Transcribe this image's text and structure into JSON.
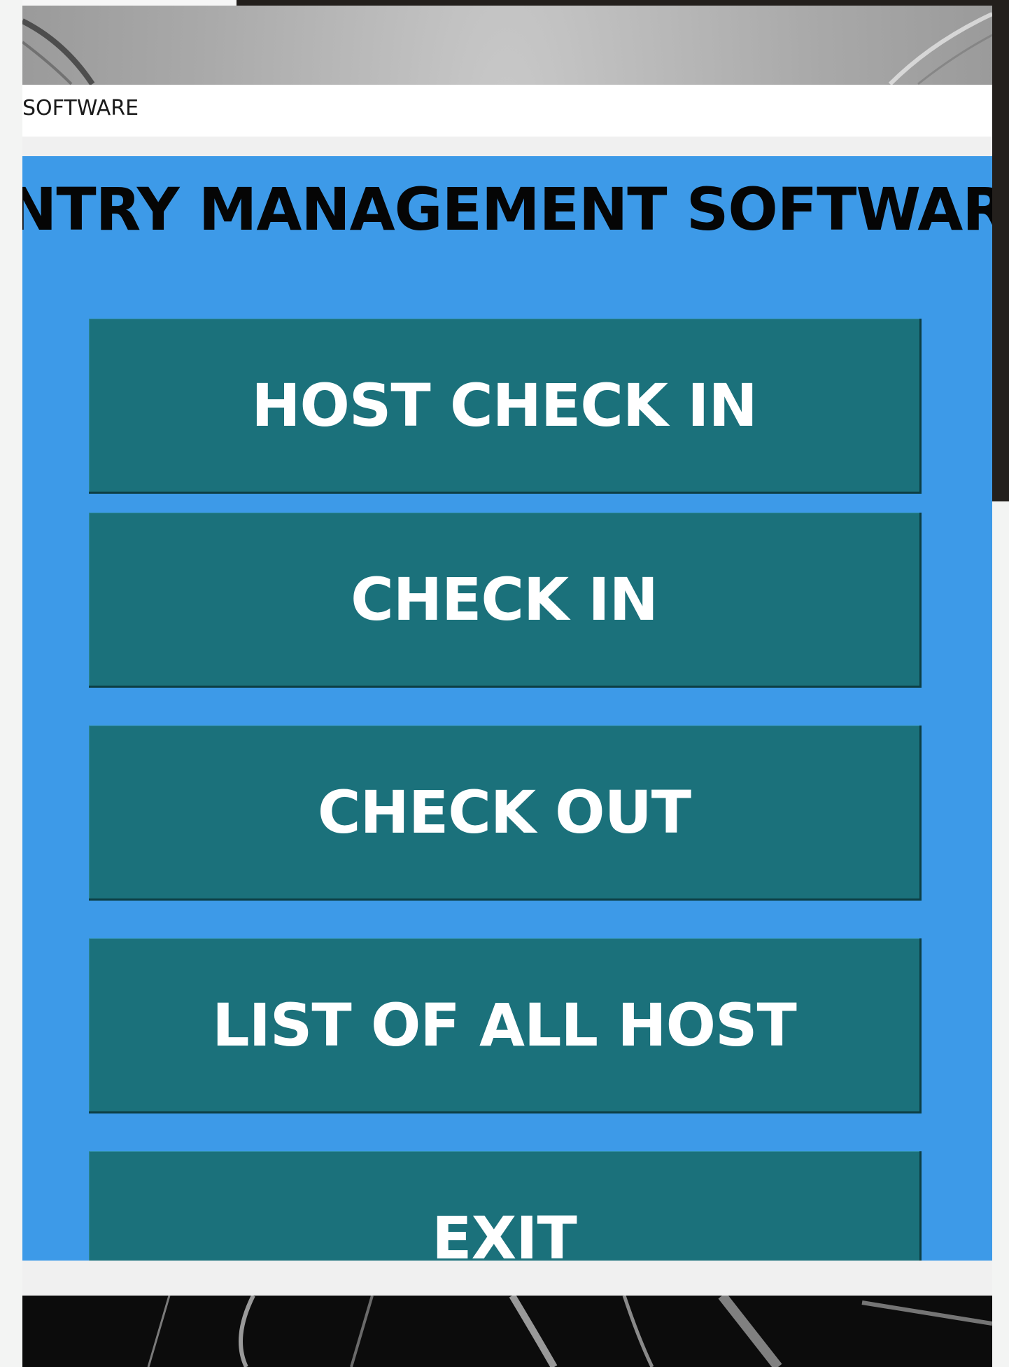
{
  "window": {
    "title": "SOFTWARE",
    "heading": "ENTRY MANAGEMENT SOFTWARE"
  },
  "menu": {
    "host_check_in": "HOST CHECK IN",
    "check_in": "CHECK IN",
    "check_out": "CHECK OUT",
    "list_of_all_host": "LIST OF ALL HOST",
    "exit": "EXIT"
  },
  "colors": {
    "panel_background": "#3d9ae8",
    "button_background": "#1b717b",
    "button_text": "#ffffff",
    "heading_text": "#050505"
  }
}
